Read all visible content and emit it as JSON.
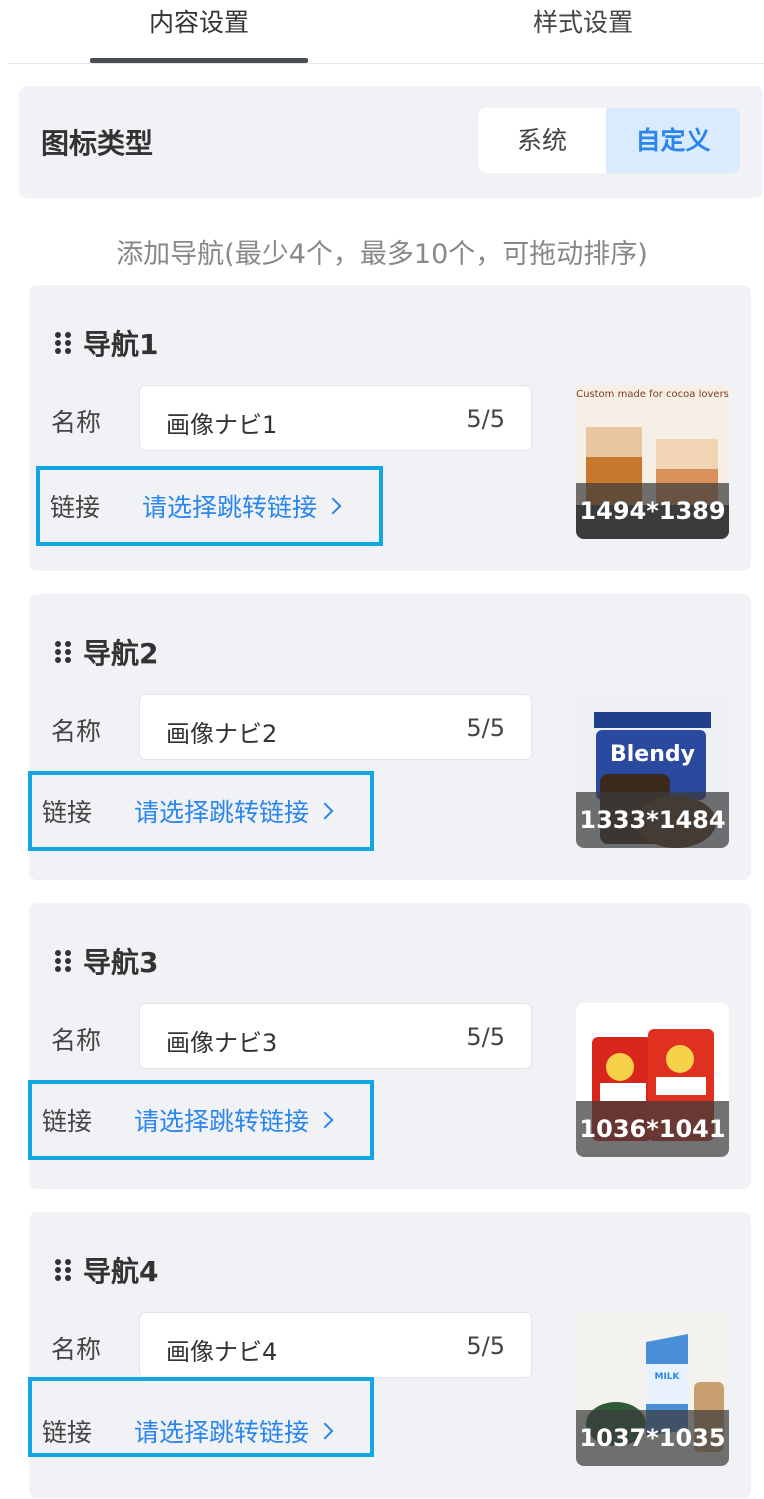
{
  "tabs": {
    "content": "内容设置",
    "style": "样式设置"
  },
  "icon_type": {
    "label": "图标类型",
    "options": [
      "系统",
      "自定义"
    ],
    "selected": "自定义"
  },
  "hint": "添加导航(最少4个，最多10个，可拖动排序)",
  "nav_items": [
    {
      "title": "导航1",
      "name_label": "名称",
      "name_value": "画像ナビ1",
      "count": "5/5",
      "link_label": "链接",
      "link_placeholder": "请选择跳转链接",
      "image_size": "1494*1389",
      "image_caption": "Custom made for cocoa lovers"
    },
    {
      "title": "导航2",
      "name_label": "名称",
      "name_value": "画像ナビ2",
      "count": "5/5",
      "link_label": "链接",
      "link_placeholder": "请选择跳转链接",
      "image_size": "1333*1484",
      "image_caption": "Blendy"
    },
    {
      "title": "导航3",
      "name_label": "名称",
      "name_value": "画像ナビ3",
      "count": "5/5",
      "link_label": "链接",
      "link_placeholder": "请选择跳转链接",
      "image_size": "1036*1041"
    },
    {
      "title": "导航4",
      "name_label": "名称",
      "name_value": "画像ナビ4",
      "count": "5/5",
      "link_label": "链接",
      "link_placeholder": "请选择跳转链接",
      "image_size": "1037*1035",
      "image_caption": "MILK"
    }
  ],
  "colors": {
    "accent": "#2a86ec",
    "highlight_border": "#12a6e2",
    "card_bg": "#f1f2f5"
  }
}
